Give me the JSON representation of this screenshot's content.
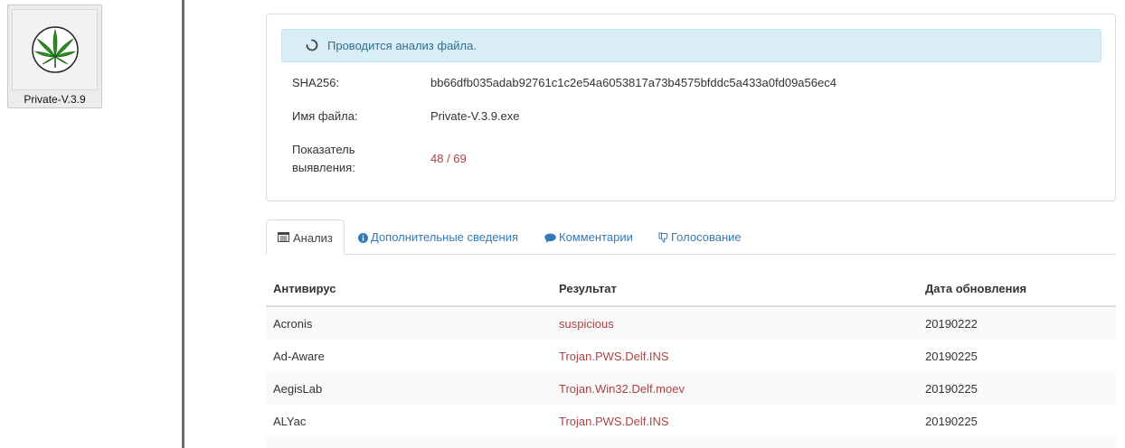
{
  "desktop": {
    "file_icon": {
      "name": "Private-V.3.9",
      "icon": "cannabis-leaf-icon"
    }
  },
  "analysis": {
    "status_text": "Проводится анализ файла.",
    "sha256_label": "SHA256:",
    "sha256_value": "bb66dfb035adab92761c1c2e54a6053817a73b4575bfddc5a433a0fd09a56ec4",
    "filename_label": "Имя файла:",
    "filename_value": "Private-V.3.9.exe",
    "detection_label_line1": "Показатель",
    "detection_label_line2": "выявления:",
    "detection_value": "48 / 69"
  },
  "tabs": [
    {
      "label": "Анализ",
      "icon": "table-icon",
      "active": true
    },
    {
      "label": "Дополнительные сведения",
      "icon": "info-icon",
      "active": false
    },
    {
      "label": "Комментарии",
      "icon": "comment-icon",
      "active": false
    },
    {
      "label": "Голосование",
      "icon": "thumbs-down-icon",
      "active": false
    }
  ],
  "table": {
    "headers": [
      "Антивирус",
      "Результат",
      "Дата обновления"
    ],
    "rows": [
      {
        "antivirus": "Acronis",
        "result": "suspicious",
        "date": "20190222"
      },
      {
        "antivirus": "Ad-Aware",
        "result": "Trojan.PWS.Delf.INS",
        "date": "20190225"
      },
      {
        "antivirus": "AegisLab",
        "result": "Trojan.Win32.Delf.moev",
        "date": "20190225"
      },
      {
        "antivirus": "ALYac",
        "result": "Trojan.PWS.Delf.INS",
        "date": "20190225"
      }
    ]
  },
  "colors": {
    "link": "#337ab7",
    "danger": "#a94442",
    "alert_bg": "#d9edf7",
    "alert_text": "#31708f"
  }
}
